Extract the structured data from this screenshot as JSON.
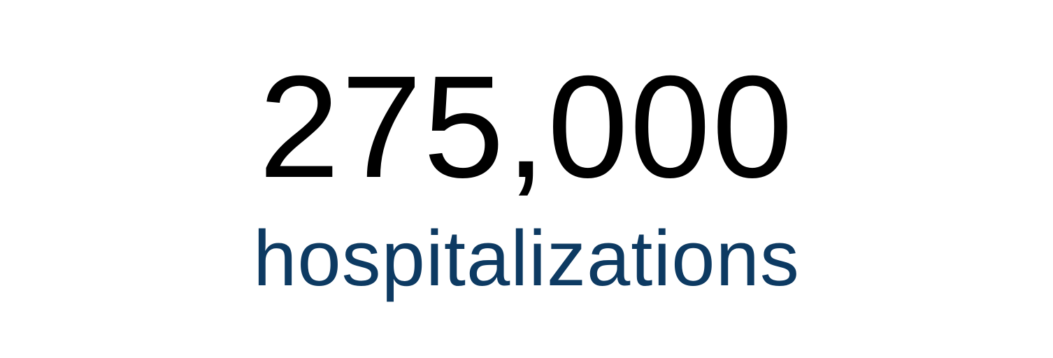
{
  "stat": {
    "value": "275,000",
    "label": "hospitalizations"
  },
  "colors": {
    "value": "#000000",
    "label": "#0d3a62",
    "background": "#ffffff"
  }
}
